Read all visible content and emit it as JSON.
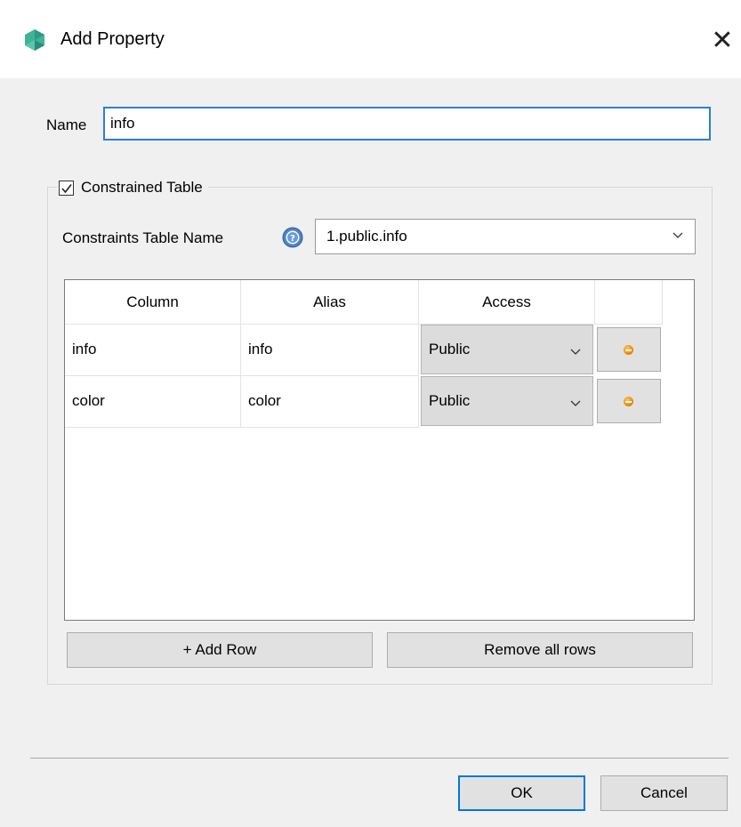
{
  "window": {
    "title": "Add Property",
    "icon": "app-logo-icon",
    "close_icon": "close-icon"
  },
  "name_field": {
    "label": "Name",
    "value": "info"
  },
  "constrained_group": {
    "checkbox_label": "Constrained Table",
    "checked": true,
    "constraints_label": "Constraints Table Name",
    "help_icon": "help-icon",
    "table_name_value": "1.public.info"
  },
  "table": {
    "headers": [
      "Column",
      "Alias",
      "Access",
      ""
    ],
    "rows": [
      {
        "column": "info",
        "alias": "info",
        "access": "Public"
      },
      {
        "column": "color",
        "alias": "color",
        "access": "Public"
      }
    ]
  },
  "buttons": {
    "add_row": "+ Add Row",
    "remove_all": "Remove all rows",
    "ok": "OK",
    "cancel": "Cancel"
  },
  "colors": {
    "focus_blue": "#2a7fd4",
    "dialog_bg": "#f0f0f0",
    "remove_dot": "#f08a00"
  }
}
